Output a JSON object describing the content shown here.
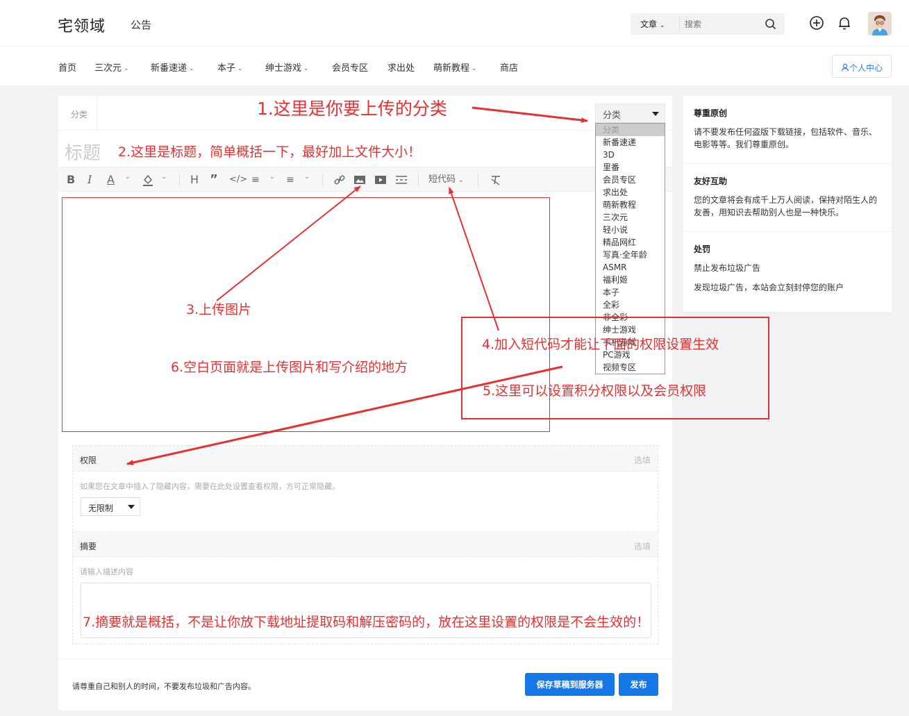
{
  "header": {
    "logo": "宅领域",
    "notice": "公告",
    "search_type": "文章",
    "search_placeholder": "搜索"
  },
  "nav": {
    "items": [
      {
        "label": "首页",
        "dropdown": false
      },
      {
        "label": "三次元",
        "dropdown": true
      },
      {
        "label": "新番速递",
        "dropdown": true
      },
      {
        "label": "本子",
        "dropdown": true
      },
      {
        "label": "绅士游戏",
        "dropdown": true
      },
      {
        "label": "会员专区",
        "dropdown": false
      },
      {
        "label": "求出处",
        "dropdown": false
      },
      {
        "label": "萌新教程",
        "dropdown": true
      },
      {
        "label": "商店",
        "dropdown": false
      }
    ],
    "user_center": "个人中心"
  },
  "editor": {
    "category_label": "分类",
    "category_select": "分类",
    "title_placeholder": "标题",
    "shortcode_label": "短代码",
    "category_options": [
      "分类",
      "新番速递",
      "3D",
      "里番",
      "会员专区",
      "求出处",
      "萌新教程",
      "三次元",
      "轻小说",
      "精品网红",
      "写真·全年龄",
      "ASMR",
      "福利姬",
      "本子",
      "全彩",
      "非全彩",
      "绅士游戏",
      "手机游戏",
      "PC游戏",
      "视频专区"
    ]
  },
  "permission": {
    "title": "权限",
    "optional": "选填",
    "desc": "如果您在文章中插入了隐藏内容，需要在此处设置查看权限，方可正常隐藏。",
    "select": "无限制"
  },
  "summary": {
    "title": "摘要",
    "optional": "选填",
    "placeholder": "请输入描述内容"
  },
  "footer": {
    "note": "请尊重自己和别人的时间，不要发布垃圾和广告内容。",
    "draft_button": "保存草稿到服务器",
    "publish_button": "发布"
  },
  "sidebar": [
    {
      "title": "尊重原创",
      "text": "请不要发布任何盗版下载链接，包括软件、音乐、电影等等。我们尊重原创。"
    },
    {
      "title": "友好互助",
      "text": "您的文章将会有成千上万人阅读，保持对陌生人的友善，用知识去帮助别人也是一种快乐。"
    },
    {
      "title": "处罚",
      "text": "禁止发布垃圾广告"
    },
    {
      "title": "",
      "text": "发现垃圾广告，本站会立刻封停您的账户"
    }
  ],
  "annotations": {
    "a1": "1.这里是你要上传的分类",
    "a2": "2.这里是标题，简单概括一下，最好加上文件大小！",
    "a3": "3.上传图片",
    "a4": "4.加入短代码才能让下面的权限设置生效",
    "a5": "5.这里可以设置积分权限以及会员权限",
    "a6": "6.空白页面就是上传图片和写介绍的地方",
    "a7": "7.摘要就是概括，不是让你放下载地址提取码和解压密码的，放在这里设置的权限是不会生效的！"
  },
  "colors": {
    "accent": "#1677e6",
    "annotation": "#e53030"
  }
}
